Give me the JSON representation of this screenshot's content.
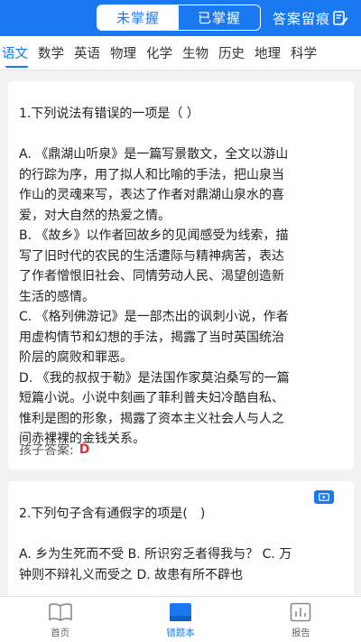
{
  "header": {
    "segments": [
      "未掌握",
      "已掌握"
    ],
    "active_segment": "未掌握",
    "answer_trace_label": "答案留痕"
  },
  "subjects": [
    "语文",
    "数学",
    "英语",
    "物理",
    "化学",
    "生物",
    "历史",
    "地理",
    "科学"
  ],
  "active_subject": "语文",
  "questions": [
    {
      "title": "1.下列说法有错误的一项是（ ）",
      "options": [
        [
          "A. 《鼎湖山听泉》是一篇写景散文，全文以游山",
          "的行踪为序，用了拟人和比喻的手法，把山泉当",
          "作山的灵魂来写，表达了作者对鼎湖山泉水的喜",
          "爱，对大自然的热爱之情。"
        ],
        [
          "B. 《故乡》以作者回故乡的见闻感受为线索，描",
          "写了旧时代的农民的生活遭际与精神病苦，表达",
          "了作者憎恨旧社会、同情劳动人民、渴望创造新",
          "生活的感情。"
        ],
        [
          "C. 《格列佛游记》是一部杰出的讽刺小说，作者",
          "用虚构情节和幻想的手法，揭露了当时英国统治",
          "阶层的腐败和罪恶。"
        ],
        [
          "D. 《我的叔叔于勒》是法国作家莫泊桑写的一篇",
          "短篇小说。小说中刻画了菲利普夫妇冷酷自私、",
          "惟利是图的形象，揭露了资本主义社会人与人之",
          "间赤裸裸的金钱关系。"
        ]
      ],
      "child_answer_label": "孩子答案:",
      "child_answer_value": "D"
    },
    {
      "title": "2.下列句子含有通假字的项是(　)",
      "options_lines": [
        "A. 乡为生死而不受 B. 所识穷乏者得我与？ C. 万",
        "钟则不辩礼义而受之 D. 故患有所不辟也"
      ]
    }
  ],
  "bottom_nav": [
    {
      "label": "首页",
      "icon": "book-icon"
    },
    {
      "label": "错题本",
      "icon": "notebook-icon"
    },
    {
      "label": "报告",
      "icon": "bar-chart-icon"
    }
  ],
  "active_nav": "错题本",
  "colors": {
    "primary": "#1a78f0",
    "answer": "#e03131"
  }
}
